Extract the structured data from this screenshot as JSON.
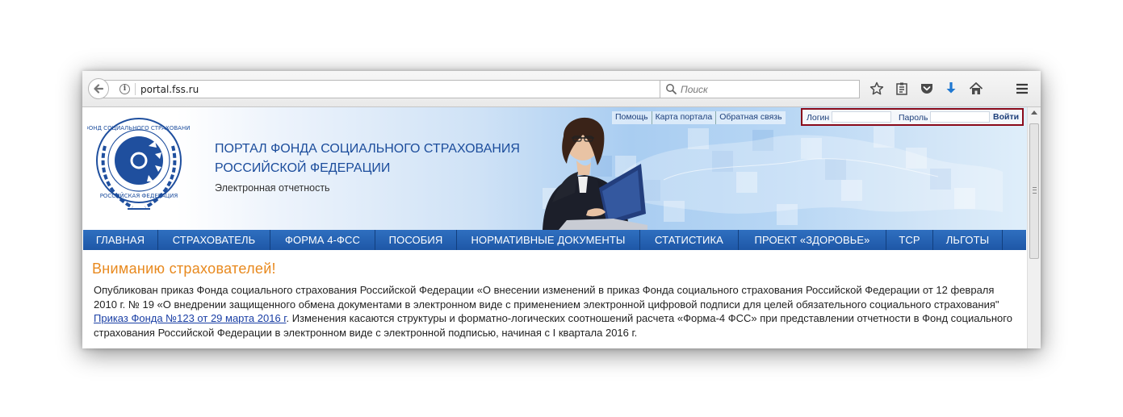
{
  "browser": {
    "url_host": "portal.",
    "url_domain": "fss.ru",
    "search_placeholder": "Поиск",
    "icons": [
      "back-arrow-icon",
      "info-icon",
      "reload-icon",
      "search-icon",
      "star-icon",
      "reading-list-icon",
      "pocket-icon",
      "download-icon",
      "home-icon",
      "menu-icon"
    ]
  },
  "header": {
    "title_line1": "ПОРТАЛ ФОНДА СОЦИАЛЬНОГО СТРАХОВАНИЯ",
    "title_line2": "РОССИЙСКОЙ ФЕДЕРАЦИИ",
    "subtitle": "Электронная отчетность",
    "top_links": [
      "Помощь",
      "Карта портала",
      "Обратная связь"
    ],
    "login_label": "Логин",
    "password_label": "Пароль",
    "login_value": "",
    "password_value": "",
    "login_button": "Войти",
    "login_border_color": "#8a0a1a"
  },
  "nav": {
    "items": [
      {
        "label": "ГЛАВНАЯ"
      },
      {
        "label": "СТРАХОВАТЕЛЬ"
      },
      {
        "label": "ФОРМА 4-ФСС"
      },
      {
        "label": "ПОСОБИЯ"
      },
      {
        "label": "НОРМАТИВНЫЕ ДОКУМЕНТЫ"
      },
      {
        "label": "СТАТИСТИКА"
      },
      {
        "label": "ПРОЕКТ «ЗДОРОВЬЕ»"
      },
      {
        "label": "ТСР"
      },
      {
        "label": "ЛЬГОТЫ"
      }
    ],
    "background_color": "#2563b0"
  },
  "notice": {
    "heading": "Вниманию страхователей!",
    "text_before": "Опубликован приказ Фонда социального страхования Российской Федерации «О внесении изменений в приказ Фонда социального страхования Российской Федерации от 12 февраля 2010 г. № 19 «О внедрении защищенного обмена документами в электронном виде с применением электронной цифровой подписи для целей обязательного социального страхования\" ",
    "link_text": "Приказ Фонда №123 от 29 марта 2016 г",
    "text_after": ". Изменения касаются структуры и форматно-логических соотношений расчета «Форма-4 ФСС» при представлении отчетности в Фонд социального страхования Российской Федерации в электронном виде с электронной подписью, начиная с I квартала 2016 г.",
    "heading_color": "#e8891e"
  }
}
